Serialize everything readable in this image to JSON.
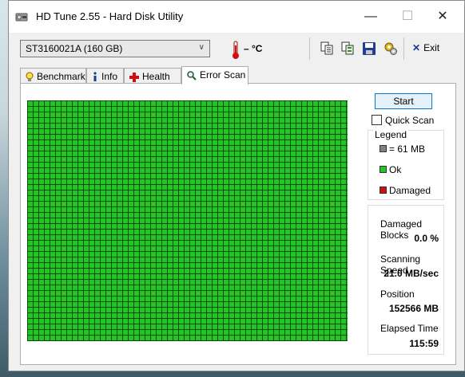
{
  "window": {
    "title": "HD Tune 2.55 - Hard Disk Utility",
    "controls": {
      "minimize": "—",
      "maximize": "☐",
      "close": "✕"
    }
  },
  "toolbar": {
    "drive": "ST3160021A (160 GB)",
    "temperature": "– °C",
    "exit_label": "Exit",
    "icons": [
      "copy-icon",
      "copy-all-icon",
      "save-icon",
      "options-icon"
    ]
  },
  "tabs": [
    {
      "label": "Benchmark",
      "icon": "lightbulb-icon",
      "active": false
    },
    {
      "label": "Info",
      "icon": "info-icon",
      "active": false
    },
    {
      "label": "Health",
      "icon": "health-cross-icon",
      "active": false
    },
    {
      "label": "Error Scan",
      "icon": "magnifier-icon",
      "active": true
    }
  ],
  "error_scan": {
    "start_label": "Start",
    "quick_scan_label": "Quick Scan",
    "quick_scan_checked": false,
    "legend": {
      "title": "Legend",
      "block_size": "= 61 MB",
      "ok": "Ok",
      "damaged": "Damaged",
      "colors": {
        "block": "#808080",
        "ok": "#22c522",
        "damaged": "#d01010"
      }
    },
    "stats": {
      "damaged_blocks_label": "Damaged Blocks",
      "damaged_blocks_value": "0.0 %",
      "scanning_speed_label": "Scanning Speed",
      "scanning_speed_value": "21.0 MB/sec",
      "position_label": "Position",
      "position_value": "152566 MB",
      "elapsed_time_label": "Elapsed Time",
      "elapsed_time_value": "115:59"
    },
    "scan_grid_state": "all blocks ok",
    "colors": {
      "ok_block": "#22c522",
      "grid_line": "#0a4a0a"
    }
  }
}
